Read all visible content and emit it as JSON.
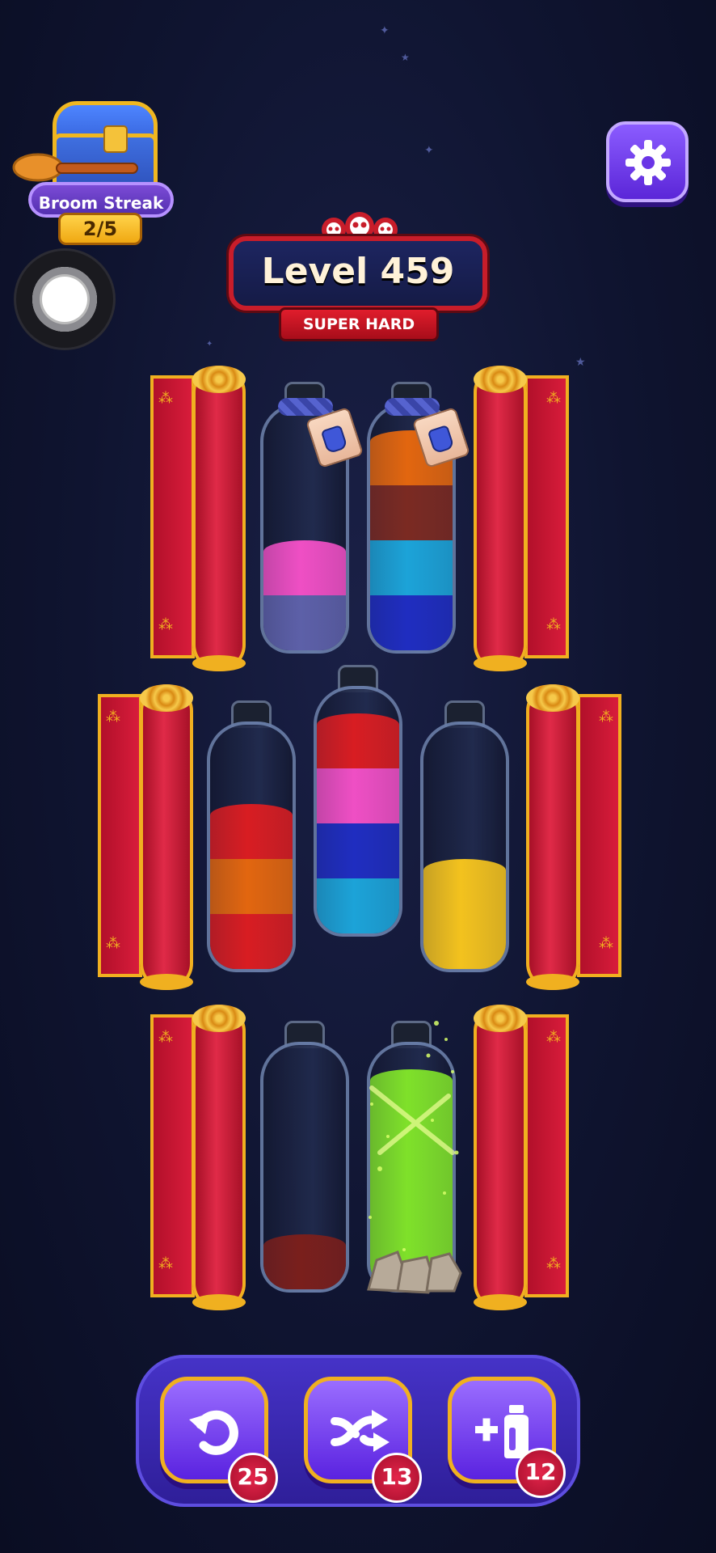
{
  "streak": {
    "label": "Broom Streak",
    "count": "2/5"
  },
  "level": {
    "title": "Level 459",
    "difficulty": "SUPER HARD"
  },
  "colors": {
    "pink": "#ef4fc4",
    "lavender": "#5d60a8",
    "orange": "#e2660f",
    "brown": "#7b2a22",
    "cyan": "#1ca3d8",
    "blue": "#1f2dc0",
    "red": "#d81d22",
    "yellow": "#f3c21e",
    "green": "#7fe12a",
    "darkred": "#7a1f1c"
  },
  "bottles": [
    {
      "name": "bottle-row1-1",
      "layers": [
        "lavender",
        "pink"
      ],
      "locked": true
    },
    {
      "name": "bottle-row1-2",
      "layers": [
        "blue",
        "cyan",
        "brown",
        "orange"
      ],
      "locked": true
    },
    {
      "name": "bottle-row2-1",
      "layers": [
        "red",
        "orange",
        "red"
      ],
      "locked": false
    },
    {
      "name": "bottle-row2-2",
      "layers": [
        "cyan",
        "blue",
        "pink",
        "red"
      ],
      "locked": false
    },
    {
      "name": "bottle-row2-3",
      "layers": [
        "yellow",
        "yellow"
      ],
      "locked": false
    },
    {
      "name": "bottle-row3-1",
      "layers": [
        "darkred"
      ],
      "locked": false
    },
    {
      "name": "bottle-row3-2",
      "layers": [
        "green",
        "green",
        "green",
        "green"
      ],
      "locked": false,
      "complete": true
    }
  ],
  "powerups": {
    "undo": {
      "icon": "undo-icon",
      "count": "25"
    },
    "shuffle": {
      "icon": "shuffle-icon",
      "count": "13"
    },
    "add_bottle": {
      "icon": "add-bottle-icon",
      "count": "12"
    }
  }
}
